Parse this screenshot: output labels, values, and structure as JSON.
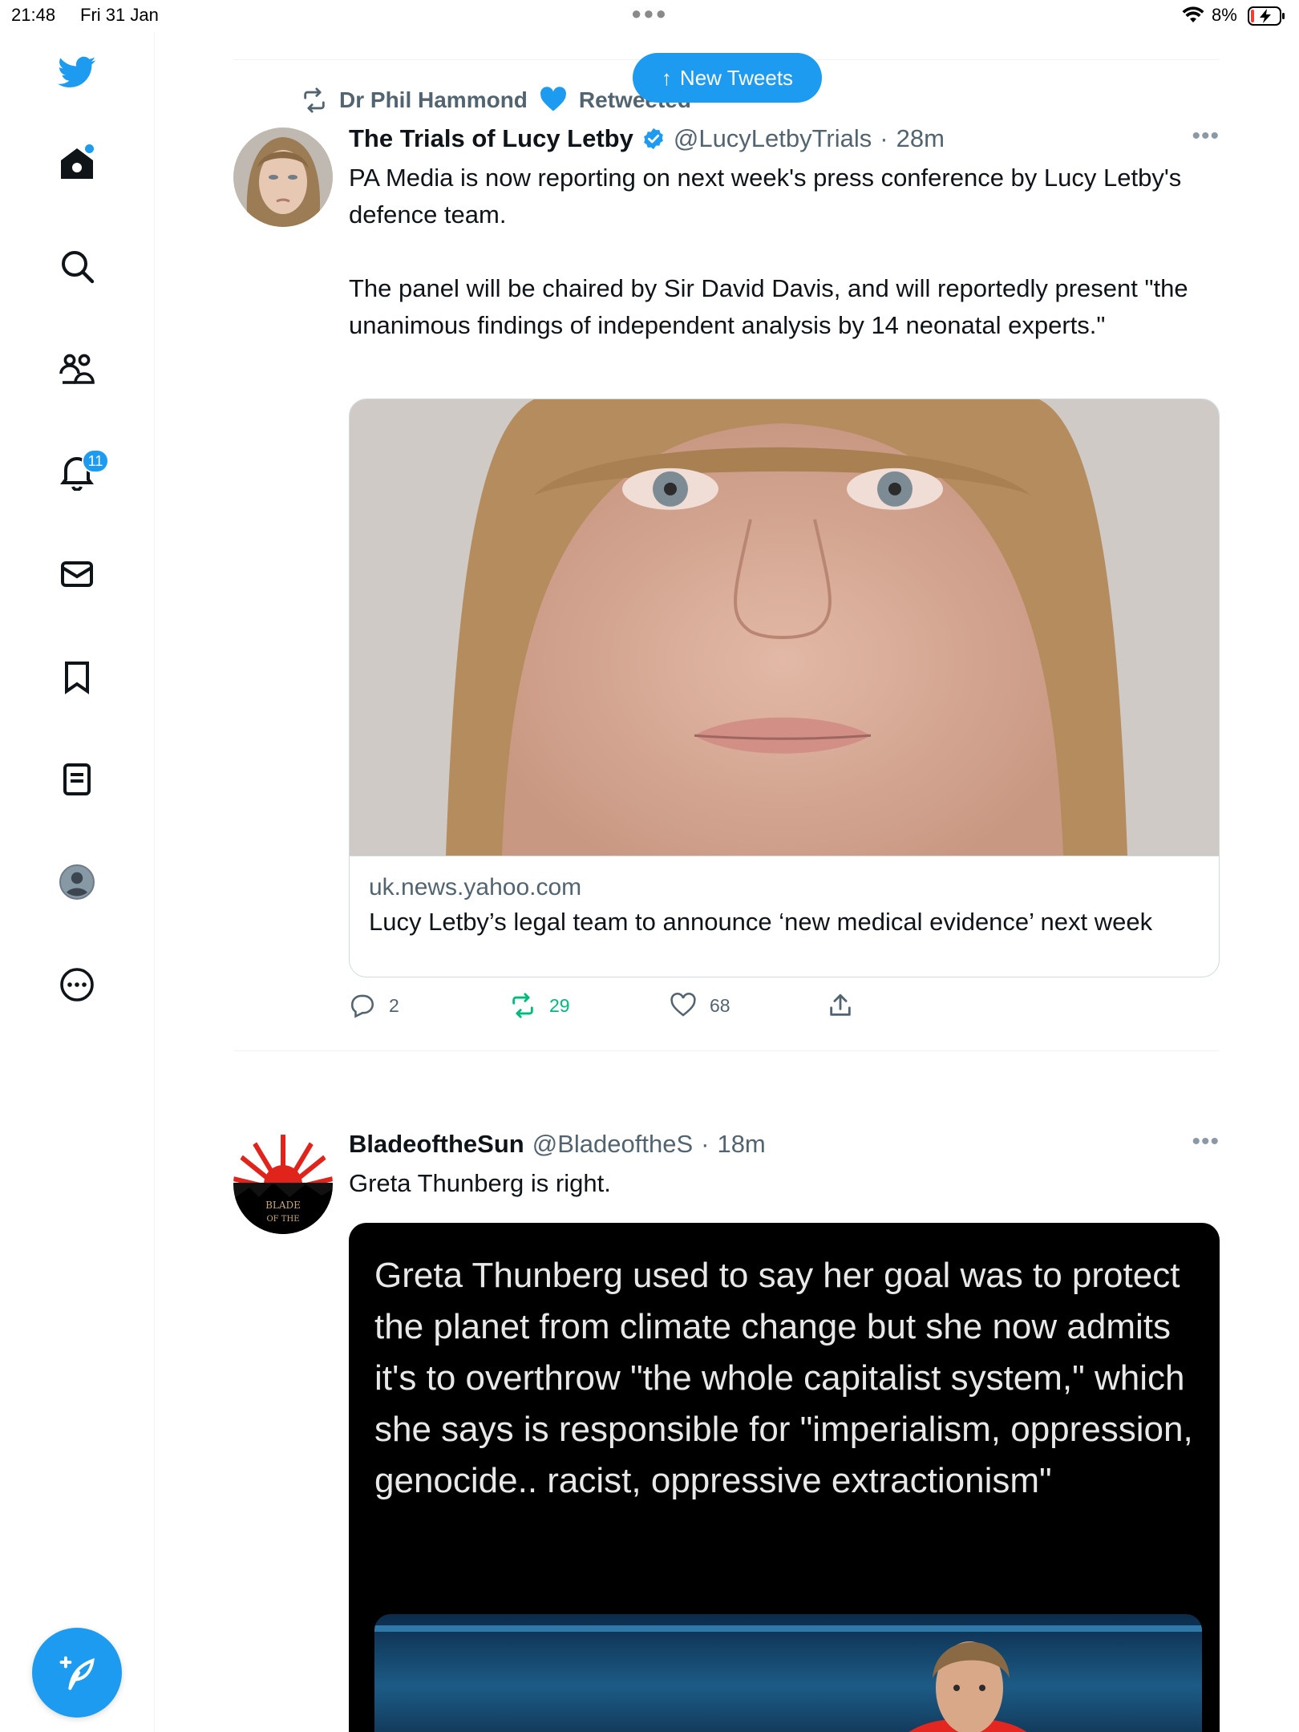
{
  "status_bar": {
    "time": "21:48",
    "date": "Fri 31 Jan",
    "battery": "8%"
  },
  "colors": {
    "accent": "#1d9bf0",
    "retweet": "#00ba7c",
    "secondary_text": "#536471",
    "border": "#eff3f4"
  },
  "sidebar": {
    "items": [
      {
        "icon": "twitter-bird-icon"
      },
      {
        "icon": "home-icon"
      },
      {
        "icon": "search-icon"
      },
      {
        "icon": "communities-icon"
      },
      {
        "icon": "notifications-bell-icon",
        "badge": "11"
      },
      {
        "icon": "messages-envelope-icon"
      },
      {
        "icon": "bookmark-icon"
      },
      {
        "icon": "lists-icon"
      },
      {
        "icon": "profile-avatar-icon"
      },
      {
        "icon": "more-circle-icon"
      }
    ],
    "compose_icon": "compose-feather-icon"
  },
  "new_tweets": {
    "label": "New Tweets"
  },
  "tweets": [
    {
      "retweeted_by": "Dr Phil Hammond",
      "retweeted_label": "Retweeted",
      "name": "The Trials of Lucy Letby",
      "handle": "@LucyLetbyTrials",
      "separator": "·",
      "time": "28m",
      "text": "PA Media is now reporting on next week's press conference by Lucy Letby's defence team.\n\nThe panel will be chaired by Sir David Davis, and will reportedly present \"the unanimous findings of independent analysis by 14 neonatal experts.\"",
      "card": {
        "domain": "uk.news.yahoo.com",
        "title": "Lucy Letby’s legal team to announce ‘new medical evidence’ next week"
      },
      "stats": {
        "replies": "2",
        "retweets": "29",
        "likes": "68"
      }
    },
    {
      "name": "BladeoftheSun",
      "handle": "@BladeoftheS",
      "separator": "·",
      "time": "18m",
      "text": "Greta Thunberg is right.",
      "media_text": "Greta Thunberg used to say her goal was to protect the planet from climate change but she now admits it's to overthrow \"the whole capitalist system,\" which she says is responsible for \"imperialism, oppression, genocide.. racist, oppressive extractionism\""
    }
  ]
}
